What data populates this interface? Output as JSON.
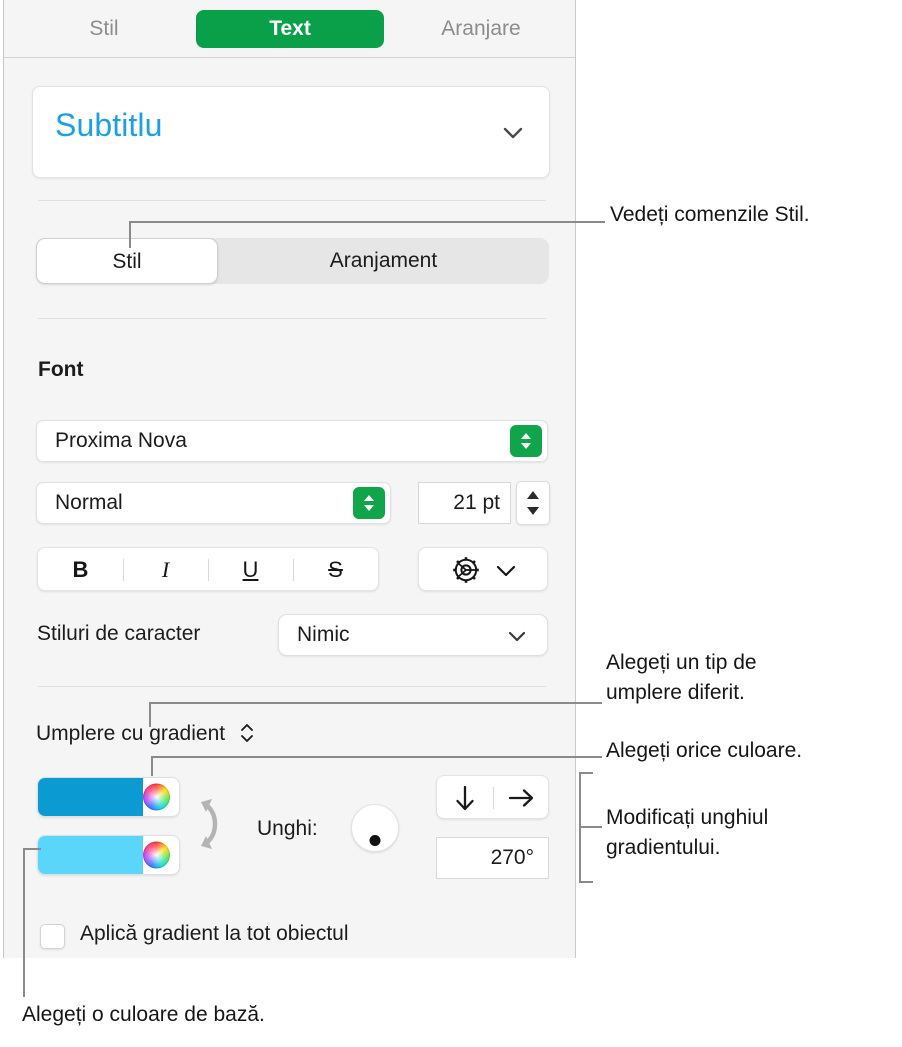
{
  "panel": {
    "tabs": [
      {
        "label": "Stil",
        "selected": false
      },
      {
        "label": "Text",
        "selected": true
      },
      {
        "label": "Aranjare",
        "selected": false
      }
    ],
    "style_picker": {
      "value": "Subtitlu",
      "chevron": "chevron-down-icon",
      "accent_color": "#1ba1e2"
    },
    "segmented": {
      "options": [
        {
          "label": "Stil",
          "selected": true
        },
        {
          "label": "Aranjament",
          "selected": false
        }
      ]
    },
    "font_section": {
      "label": "Font",
      "family": "Proxima Nova",
      "weight": "Normal",
      "size": "21 pt",
      "formatting": [
        {
          "label": "B",
          "name": "bold"
        },
        {
          "label": "I",
          "name": "italic"
        },
        {
          "label": "U",
          "name": "underline"
        },
        {
          "label": "S",
          "name": "strikethrough"
        }
      ],
      "options_icon": "gear-icon",
      "character_styles_label": "Stiluri de caracter",
      "character_styles_value": "Nimic"
    },
    "fill_section": {
      "fill_type": "Umplere cu gradient",
      "fill_type_stepper": "up-down-chevron-icon",
      "color_start": "#0b9ad2",
      "color_end": "#5ad6fb",
      "swap_icon": "swap-colors-icon",
      "angle_label": "Unghi:",
      "angle_value": "270°",
      "angle_dial": "angle-dial",
      "direction_buttons": [
        {
          "name": "gradient-direction-down",
          "glyph": "↓"
        },
        {
          "name": "gradient-direction-right",
          "glyph": "→"
        }
      ],
      "checkbox_label": "Aplică gradient la tot obiectul",
      "checkbox_checked": false
    }
  },
  "callouts": {
    "style_controls": "Vedeți comenzile Stil.",
    "fill_type": "Alegeți un tip de\numplere diferit.",
    "any_color": "Alegeți orice culoare.",
    "gradient_angle": "Modificați unghiul\ngradientului.",
    "base_color": "Alegeți o culoare de bază."
  },
  "colors": {
    "accent_green": "#0aa04a",
    "link_blue": "#1ba1e2",
    "panel_bg": "#f5f5f5",
    "leader_line": "#8a8a8a"
  }
}
